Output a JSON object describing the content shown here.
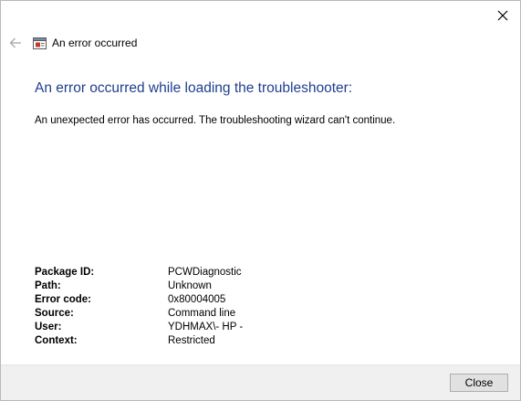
{
  "window": {
    "close_icon": "close-icon"
  },
  "header": {
    "back_icon": "back-arrow-icon",
    "app_icon": "troubleshooter-icon",
    "title": "An error occurred"
  },
  "main": {
    "heading": "An error occurred while loading the troubleshooter:",
    "message": "An unexpected error has occurred. The troubleshooting wizard can't continue."
  },
  "details": [
    {
      "label": "Package ID:",
      "value": "PCWDiagnostic"
    },
    {
      "label": "Path:",
      "value": "Unknown"
    },
    {
      "label": "Error code:",
      "value": "0x80004005"
    },
    {
      "label": "Source:",
      "value": "Command line"
    },
    {
      "label": "User:",
      "value": "YDHMAX\\- HP -"
    },
    {
      "label": "Context:",
      "value": "Restricted"
    }
  ],
  "footer": {
    "close_label": "Close"
  },
  "colors": {
    "heading": "#1e3f8f",
    "footer_bg": "#f0f0f0",
    "button_bg": "#e1e1e1"
  }
}
